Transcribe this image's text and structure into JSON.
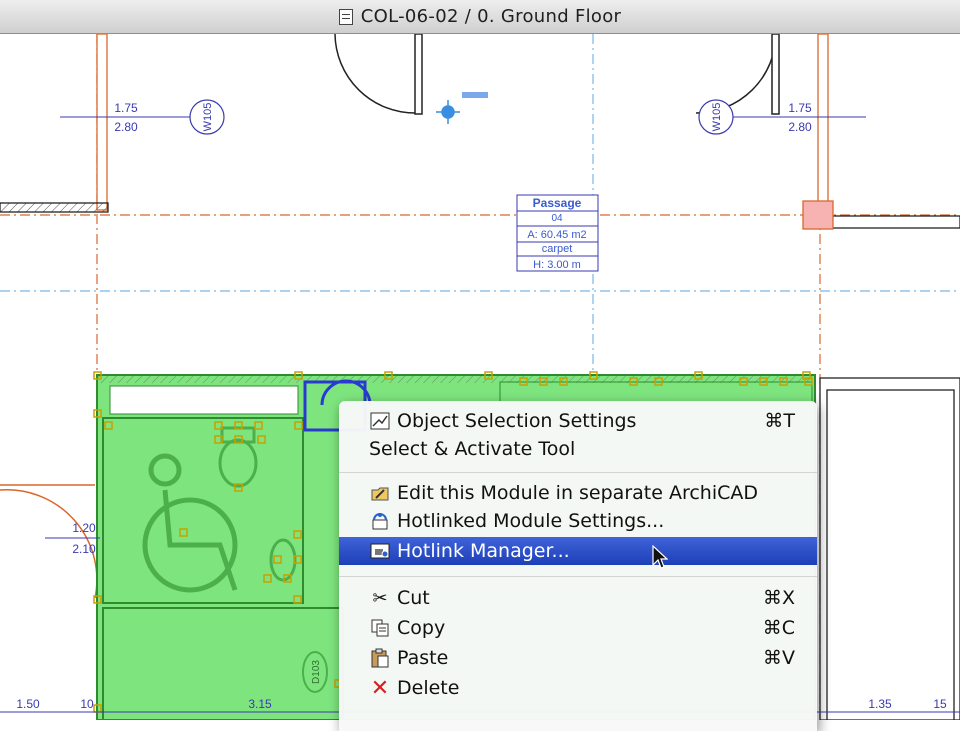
{
  "window": {
    "title": "COL-06-02 / 0. Ground Floor"
  },
  "plan": {
    "doors": [
      {
        "dims_top": "1.75",
        "dims_bottom": "2.80",
        "tag": "W105"
      },
      {
        "dims_top": "1.75",
        "dims_bottom": "2.80",
        "tag": "W105"
      },
      {
        "dims_top": "1.20",
        "dims_bottom": "2.10"
      }
    ],
    "zone_stamp": {
      "name": "Passage",
      "number": "04",
      "area": "A: 60.45 m2",
      "finish": "carpet",
      "height": "H: 3.00 m"
    },
    "door_tag_lower": "D103",
    "dimensions": [
      "1.50",
      "10",
      "3.15",
      "1.35",
      "15"
    ]
  },
  "context_menu": {
    "items": [
      {
        "label": "Object Selection Settings",
        "shortcut": "⌘T",
        "icon": "object-settings-icon"
      },
      {
        "label": "Select & Activate Tool"
      },
      {
        "label": "Edit this Module in separate ArchiCAD",
        "icon": "edit-module-icon"
      },
      {
        "label": "Hotlinked Module Settings...",
        "icon": "hotlink-settings-icon"
      },
      {
        "label": "Hotlink Manager...",
        "icon": "hotlink-manager-icon",
        "highlighted": true
      },
      {
        "label": "Cut",
        "shortcut": "⌘X",
        "icon": "scissors-icon"
      },
      {
        "label": "Copy",
        "shortcut": "⌘C",
        "icon": "copy-icon"
      },
      {
        "label": "Paste",
        "shortcut": "⌘V",
        "icon": "paste-icon"
      },
      {
        "label": "Delete",
        "icon": "delete-icon"
      }
    ]
  },
  "colors": {
    "selection_fill": "#7ee57e",
    "handle": "#c9a000",
    "highlight": "#2b4fc8",
    "grid_orange": "#d9662a",
    "grid_blue": "#79b8e8",
    "wall_blue": "#3a3ab0"
  }
}
